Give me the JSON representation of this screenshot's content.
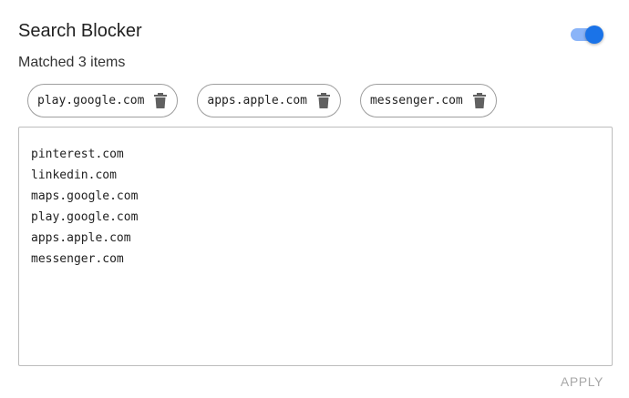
{
  "header": {
    "title": "Search Blocker",
    "toggle": {
      "state": "on",
      "accent_color": "#1a73e8",
      "track_color": "#8ab4f8"
    }
  },
  "status": {
    "matched_text": "Matched 3 items"
  },
  "chips": [
    {
      "label": "play.google.com",
      "icon": "trash-icon"
    },
    {
      "label": "apps.apple.com",
      "icon": "trash-icon"
    },
    {
      "label": "messenger.com",
      "icon": "trash-icon"
    }
  ],
  "blocklist": {
    "value": "pinterest.com\nlinkedin.com\nmaps.google.com\nplay.google.com\napps.apple.com\nmessenger.com"
  },
  "actions": {
    "apply_label": "APPLY",
    "apply_color": "#a8a8a8"
  }
}
